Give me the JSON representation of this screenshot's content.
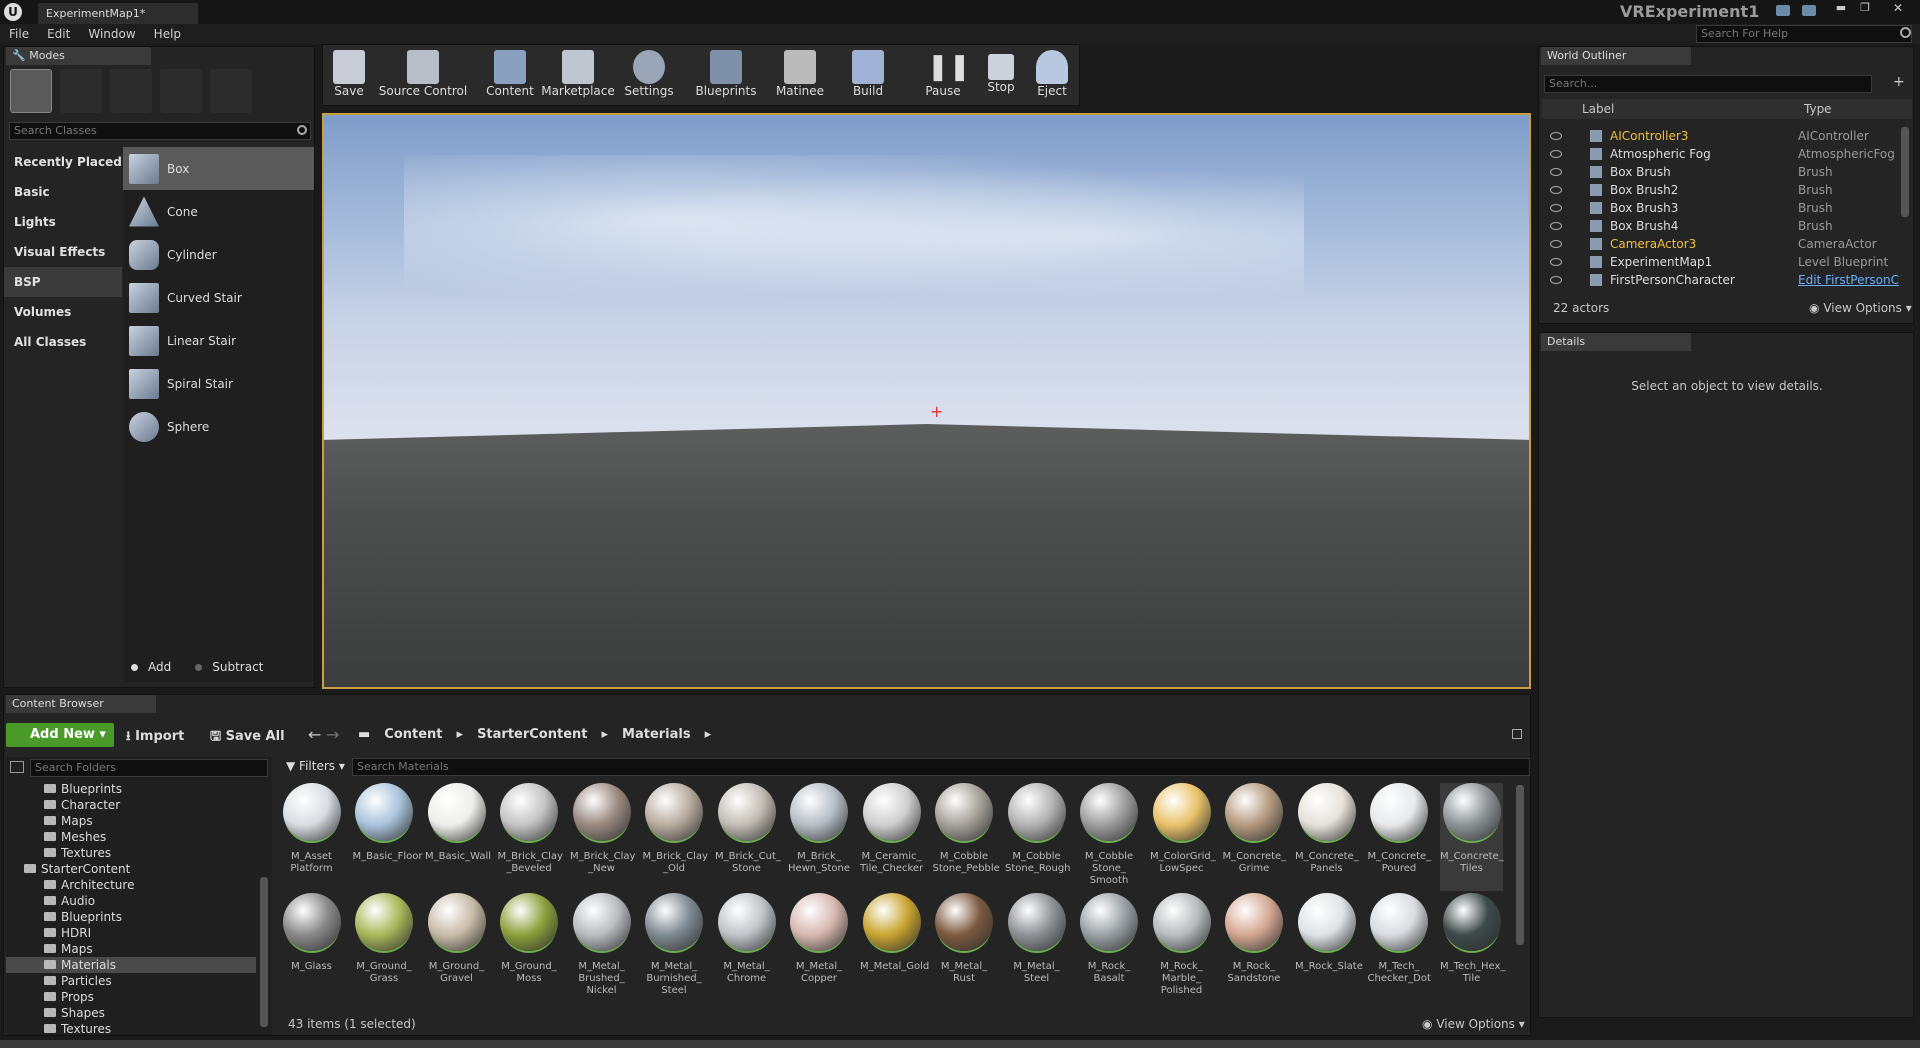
{
  "window": {
    "tab_title": "ExperimentMap1*",
    "project": "VRExperiment1",
    "help_search": "Search For Help"
  },
  "menu": [
    "File",
    "Edit",
    "Window",
    "Help"
  ],
  "modes": {
    "tab": "Modes",
    "search_placeholder": "Search Classes",
    "categories": [
      "Recently Placed",
      "Basic",
      "Lights",
      "Visual Effects",
      "BSP",
      "Volumes",
      "All Classes"
    ],
    "selected_category": "BSP",
    "items": [
      "Box",
      "Cone",
      "Cylinder",
      "Curved Stair",
      "Linear Stair",
      "Spiral Stair",
      "Sphere"
    ],
    "add_label": "Add",
    "subtract_label": "Subtract"
  },
  "toolbar": [
    "Save",
    "Source Control",
    "Content",
    "Marketplace",
    "Settings",
    "Blueprints",
    "Matinee",
    "Build",
    "Pause",
    "Stop",
    "Eject"
  ],
  "outliner": {
    "tab": "World Outliner",
    "search_placeholder": "Search...",
    "col_label": "Label",
    "col_type": "Type",
    "rows": [
      {
        "label": "AIController3",
        "type": "AIController",
        "highlight": true
      },
      {
        "label": "Atmospheric Fog",
        "type": "AtmosphericFog"
      },
      {
        "label": "Box Brush",
        "type": "Brush"
      },
      {
        "label": "Box Brush2",
        "type": "Brush"
      },
      {
        "label": "Box Brush3",
        "type": "Brush"
      },
      {
        "label": "Box Brush4",
        "type": "Brush"
      },
      {
        "label": "CameraActor3",
        "type": "CameraActor",
        "highlight": true
      },
      {
        "label": "ExperimentMap1",
        "type": "Level Blueprint"
      },
      {
        "label": "FirstPersonCharacter",
        "type": "Edit FirstPersonC",
        "link": true
      }
    ],
    "count": "22 actors",
    "view_options": "View Options"
  },
  "details": {
    "tab": "Details",
    "empty_text": "Select an object to view details."
  },
  "content_browser": {
    "tab": "Content Browser",
    "add_new": "Add New",
    "import": "Import",
    "save_all": "Save All",
    "breadcrumb": [
      "Content",
      "StarterContent",
      "Materials"
    ],
    "folder_search": "Search Folders",
    "filters": "Filters",
    "asset_search": "Search Materials",
    "tree": [
      {
        "name": "Blueprints",
        "indent": 1
      },
      {
        "name": "Character",
        "indent": 1
      },
      {
        "name": "Maps",
        "indent": 1
      },
      {
        "name": "Meshes",
        "indent": 1
      },
      {
        "name": "Textures",
        "indent": 1
      },
      {
        "name": "StarterContent",
        "indent": 0
      },
      {
        "name": "Architecture",
        "indent": 1
      },
      {
        "name": "Audio",
        "indent": 1
      },
      {
        "name": "Blueprints",
        "indent": 1
      },
      {
        "name": "HDRI",
        "indent": 1
      },
      {
        "name": "Maps",
        "indent": 1
      },
      {
        "name": "Materials",
        "indent": 1,
        "selected": true
      },
      {
        "name": "Particles",
        "indent": 1
      },
      {
        "name": "Props",
        "indent": 1
      },
      {
        "name": "Shapes",
        "indent": 1
      },
      {
        "name": "Textures",
        "indent": 1
      }
    ],
    "assets": [
      {
        "name": "M_Asset Platform",
        "color": "#d8dde2"
      },
      {
        "name": "M_Basic_Floor",
        "color": "#a9c3db"
      },
      {
        "name": "M_Basic_Wall",
        "color": "#eeeeea"
      },
      {
        "name": "M_Brick_Clay _Beveled",
        "color": "#c4c4c4"
      },
      {
        "name": "M_Brick_Clay _New",
        "color": "#9a8a80"
      },
      {
        "name": "M_Brick_Clay _Old",
        "color": "#b9aca0"
      },
      {
        "name": "M_Brick_Cut_ Stone",
        "color": "#c2bdb4"
      },
      {
        "name": "M_Brick_ Hewn_Stone",
        "color": "#b7bec6"
      },
      {
        "name": "M_Ceramic_ Tile_Checker",
        "color": "#cfcfcf"
      },
      {
        "name": "M_Cobble Stone_Pebble",
        "color": "#a6a29a"
      },
      {
        "name": "M_Cobble Stone_Rough",
        "color": "#b3b3b3"
      },
      {
        "name": "M_Cobble Stone_ Smooth",
        "color": "#9e9e9e"
      },
      {
        "name": "M_ColorGrid_ LowSpec",
        "color": "#e9c26a"
      },
      {
        "name": "M_Concrete_ Grime",
        "color": "#b59a80"
      },
      {
        "name": "M_Concrete_ Panels",
        "color": "#e6e2da"
      },
      {
        "name": "M_Concrete_ Poured",
        "color": "#e6e8ea"
      },
      {
        "name": "M_Concrete_ Tiles",
        "color": "#8d9396"
      },
      {
        "name": "M_Glass",
        "color": "#8a8a8a"
      },
      {
        "name": "M_Ground_ Grass",
        "color": "#a9b85a"
      },
      {
        "name": "M_Ground_ Gravel",
        "color": "#c8bca8"
      },
      {
        "name": "M_Ground_ Moss",
        "color": "#8ea03c"
      },
      {
        "name": "M_Metal_ Brushed_ Nickel",
        "color": "#b9bcc0"
      },
      {
        "name": "M_Metal_ Burnished_ Steel",
        "color": "#7f8a92"
      },
      {
        "name": "M_Metal_ Chrome",
        "color": "#c0c4c8"
      },
      {
        "name": "M_Metal_ Copper",
        "color": "#d7b8b0"
      },
      {
        "name": "M_Metal_Gold",
        "color": "#c9a531"
      },
      {
        "name": "M_Metal_ Rust",
        "color": "#7c5a40"
      },
      {
        "name": "M_Metal_ Steel",
        "color": "#8e9296"
      },
      {
        "name": "M_Rock_ Basalt",
        "color": "#9ba2a6"
      },
      {
        "name": "M_Rock_ Marble_ Polished",
        "color": "#b8bcbd"
      },
      {
        "name": "M_Rock_ Sandstone",
        "color": "#d4a892"
      },
      {
        "name": "M_Rock_Slate",
        "color": "#dfe3e6"
      },
      {
        "name": "M_Tech_ Checker_Dot",
        "color": "#d8dce0"
      },
      {
        "name": "M_Tech_Hex_ Tile",
        "color": "#3e4a4a"
      }
    ],
    "selected_asset": "M_Concrete_ Tiles",
    "status": "43 items (1 selected)",
    "view_options": "View Options"
  },
  "colors": {
    "accent_green": "#4a9a2a",
    "highlight_orange": "#f0c040",
    "link_blue": "#6ab0ff"
  }
}
